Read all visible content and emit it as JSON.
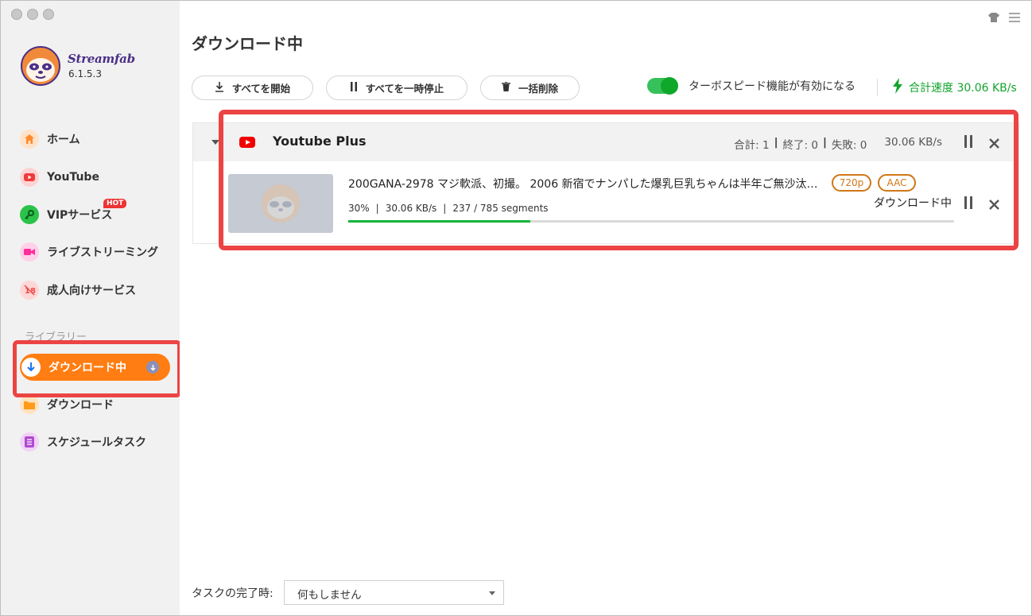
{
  "app": {
    "brand": "Streamfab",
    "version": "6.1.5.3"
  },
  "sidebar": {
    "items": [
      {
        "label": "ホーム",
        "icon": "home-icon",
        "color": "#ff8a2a"
      },
      {
        "label": "YouTube",
        "icon": "youtube-icon",
        "color": "#f03a3a"
      },
      {
        "label": "VIPサービス",
        "icon": "key-icon",
        "color": "#2bc24a",
        "badge": "HOT"
      },
      {
        "label": "ライブストリーミング",
        "icon": "camera-icon",
        "color": "#ff2f9a"
      },
      {
        "label": "成人向けサービス",
        "icon": "adult-18-icon",
        "color": "#f04a4a"
      }
    ],
    "library_label": "ライブラリー",
    "library_items": [
      {
        "label": "ダウンロード中",
        "icon": "download-arrow-icon",
        "active": true
      },
      {
        "label": "ダウンロード",
        "icon": "folder-icon",
        "color": "#ff9a1a"
      },
      {
        "label": "スケジュールタスク",
        "icon": "task-list-icon",
        "color": "#b04ad0"
      }
    ]
  },
  "main": {
    "title": "ダウンロード中",
    "toolbar": {
      "start_all": "すべてを開始",
      "pause_all": "すべてを一時停止",
      "delete_all": "一括削除"
    },
    "turbo_label": "ターボスピード機能が有効になる",
    "turbo_enabled": true,
    "total_speed": "合計速度 30.06 KB/s"
  },
  "group": {
    "name": "Youtube Plus",
    "total": "合計: 1",
    "finished": "終了: 0",
    "failed": "失敗: 0",
    "speed": "30.06 KB/s",
    "item": {
      "title": "200GANA-2978 マジ軟派、初撮。 2006 新宿でナンパした爆乳巨乳ちゃんは半年ご無沙汰…",
      "quality": "720p",
      "audio": "AAC",
      "percent": "30%",
      "speed": "30.06 KB/s",
      "segments": "237 / 785 segments",
      "status": "ダウンロード中",
      "progress": 0.3
    }
  },
  "footer": {
    "label": "タスクの完了時:",
    "select_value": "何もしません"
  },
  "colors": {
    "accent": "#ff7d12",
    "highlight": "#ec4444",
    "success": "#12a52c"
  }
}
